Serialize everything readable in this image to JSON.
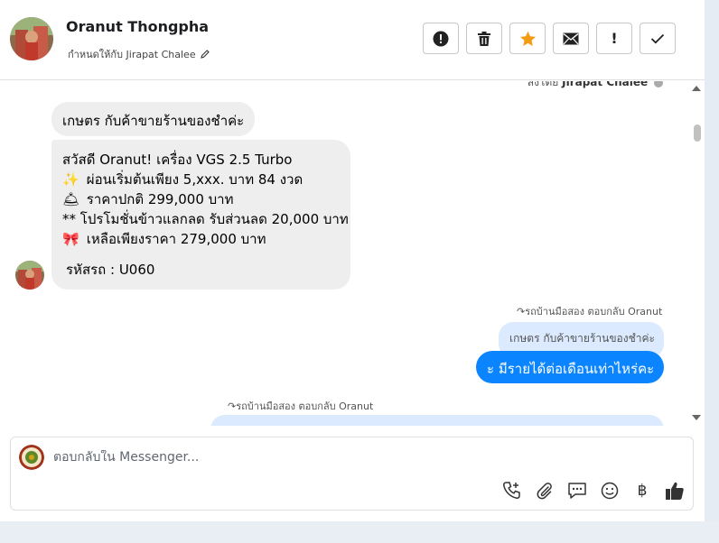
{
  "header": {
    "contact_name": "Oranut Thongpha",
    "assigned_label": "กำหนดให้กับ Jirapat Chalee",
    "actions": [
      {
        "name": "spam-button",
        "icon": "alert-circle-icon"
      },
      {
        "name": "delete-button",
        "icon": "trash-icon"
      },
      {
        "name": "star-button",
        "icon": "star-icon",
        "color": "#f39c12"
      },
      {
        "name": "mark-unread-button",
        "icon": "envelope-icon"
      },
      {
        "name": "follow-up-button",
        "icon": "exclamation-icon",
        "text": "!"
      },
      {
        "name": "done-button",
        "icon": "check-icon"
      }
    ]
  },
  "conversation": {
    "sent_by_prefix": "ส่งโดย",
    "sent_by_name": "Jirapat Chalee",
    "incoming": [
      {
        "text": "เกษตร กับค้าขายร้านของชำค่ะ"
      },
      {
        "lines": [
          {
            "emoji": "",
            "text": "สวัสดี Oranut! เครื่อง VGS 2.5 Turbo"
          },
          {
            "emoji": "✨",
            "text": "ผ่อนเริ่มต้นเพียง 5,xxx. บาท 84 งวด"
          },
          {
            "emoji": "🛎",
            "text": "ราคาปกติ 299,000 บาท"
          },
          {
            "emoji": "",
            "text": "** โปรโมชั่นข้าวแลกลด รับส่วนลด 20,000 บาท"
          },
          {
            "emoji": "🎀",
            "text": "เหลือเพียงราคา 279,000 บาท"
          },
          {
            "emoji": "",
            "text": ""
          },
          {
            "emoji": "",
            "text": "รหัสรถ : U060"
          }
        ]
      }
    ],
    "reply_label_1": "รถบ้านมือสอง ตอบกลับ Oranut",
    "reply_quote_1": "เกษตร กับค้าขายร้านของชำค่ะ",
    "outgoing_1": "ะ มีรายได้ต่อเดือนเท่าไหร่คะ",
    "reply_label_2": "รถบ้านมือสอง ตอบกลับ Oranut"
  },
  "composer": {
    "placeholder": "ตอบกลับใน Messenger...",
    "tools": [
      "add-call-icon",
      "paperclip-icon",
      "message-icon",
      "emoji-icon",
      "baht-icon",
      "thumbs-up-icon"
    ],
    "baht_symbol": "฿"
  },
  "colors": {
    "outgoing_bubble": "#0b84ff",
    "quote_bubble": "#dbeafe",
    "incoming_bubble": "#eeeeee",
    "star": "#f39c12"
  }
}
